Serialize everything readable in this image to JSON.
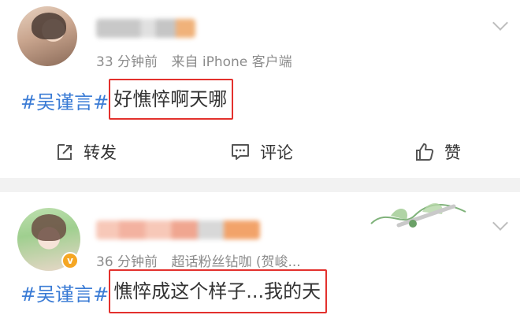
{
  "posts": [
    {
      "time": "33 分钟前",
      "source": "来自 iPhone 客户端",
      "topic": "#吴谨言#",
      "text": "好憔悴啊天哪",
      "actions": {
        "repost": "转发",
        "comment": "评论",
        "like": "赞"
      }
    },
    {
      "time": "36 分钟前",
      "source": "超话粉丝钻咖 (贺峻...",
      "topic": "#吴谨言#",
      "text": "憔悴成这个样子...我的天"
    }
  ],
  "colors": {
    "topic": "#3a7bd5",
    "highlight_box": "#e3312d",
    "meta_text": "#8c8c8c",
    "separator": "#f2f2f2",
    "verified_badge": "#f5a623"
  }
}
